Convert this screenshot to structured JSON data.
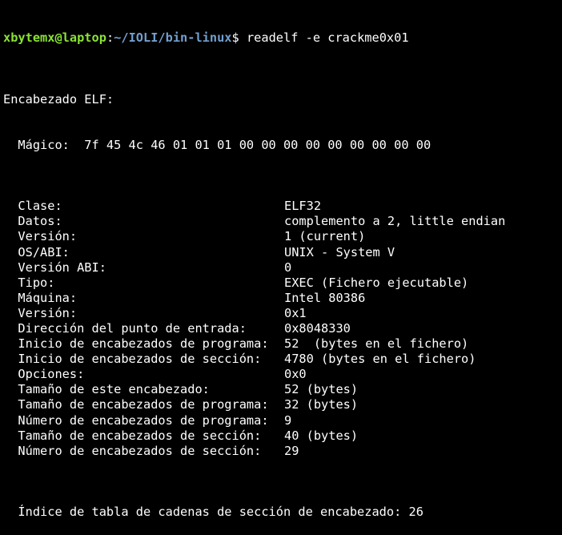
{
  "prompt": {
    "user_host": "xbytemx@laptop",
    "separator": ":",
    "path": "~/IOLI/bin-linux",
    "symbol": "$ ",
    "command": "readelf -e crackme0x01"
  },
  "output": {
    "header": "Encabezado ELF:",
    "magic": "  Mágico:  7f 45 4c 46 01 01 01 00 00 00 00 00 00 00 00 00",
    "rows": [
      {
        "field": "  Clase:",
        "value": "ELF32"
      },
      {
        "field": "  Datos:",
        "value": "complemento a 2, little endian"
      },
      {
        "field": "  Versión:",
        "value": "1 (current)"
      },
      {
        "field": "  OS/ABI:",
        "value": "UNIX - System V"
      },
      {
        "field": "  Versión ABI:",
        "value": "0"
      },
      {
        "field": "  Tipo:",
        "value": "EXEC (Fichero ejecutable)"
      },
      {
        "field": "  Máquina:",
        "value": "Intel 80386"
      },
      {
        "field": "  Versión:",
        "value": "0x1"
      },
      {
        "field": "  Dirección del punto de entrada:",
        "value": "0x8048330"
      },
      {
        "field": "  Inicio de encabezados de programa:",
        "value": "52  (bytes en el fichero)"
      },
      {
        "field": "  Inicio de encabezados de sección:",
        "value": "4780 (bytes en el fichero)"
      },
      {
        "field": "  Opciones:",
        "value": "0x0"
      },
      {
        "field": "  Tamaño de este encabezado:",
        "value": "52 (bytes)"
      },
      {
        "field": "  Tamaño de encabezados de programa:",
        "value": "32 (bytes)"
      },
      {
        "field": "  Número de encabezados de programa:",
        "value": "9"
      },
      {
        "field": "  Tamaño de encabezados de sección:",
        "value": "40 (bytes)"
      },
      {
        "field": "  Número de encabezados de sección:",
        "value": "29"
      }
    ],
    "last_line": "  Índice de tabla de cadenas de sección de encabezado: 26"
  }
}
